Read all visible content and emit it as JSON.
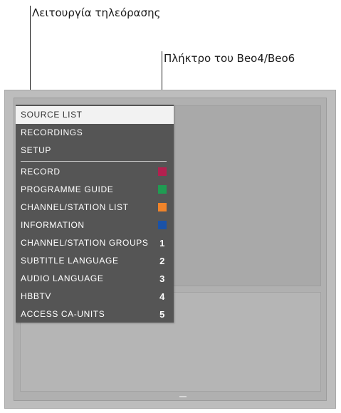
{
  "callouts": {
    "tv_mode": "Λειτουργία τηλεόρασης",
    "remote_key": "Πλήκτρο του Beo4/Beo6"
  },
  "menu": {
    "top_items": [
      {
        "label": "SOURCE LIST",
        "selected": true
      },
      {
        "label": "RECORDINGS",
        "selected": false
      },
      {
        "label": "SETUP",
        "selected": false
      }
    ],
    "color_items": [
      {
        "label": "RECORD",
        "color": "#b3204f"
      },
      {
        "label": "PROGRAMME GUIDE",
        "color": "#1f9c52"
      },
      {
        "label": "CHANNEL/STATION LIST",
        "color": "#f0842a"
      },
      {
        "label": "INFORMATION",
        "color": "#1a52a8"
      }
    ],
    "number_items": [
      {
        "label": "CHANNEL/STATION GROUPS",
        "key": "1"
      },
      {
        "label": "SUBTITLE LANGUAGE",
        "key": "2"
      },
      {
        "label": "AUDIO LANGUAGE",
        "key": "3"
      },
      {
        "label": "HBBTV",
        "key": "4"
      },
      {
        "label": "ACCESS CA-UNITS",
        "key": "5"
      }
    ]
  }
}
